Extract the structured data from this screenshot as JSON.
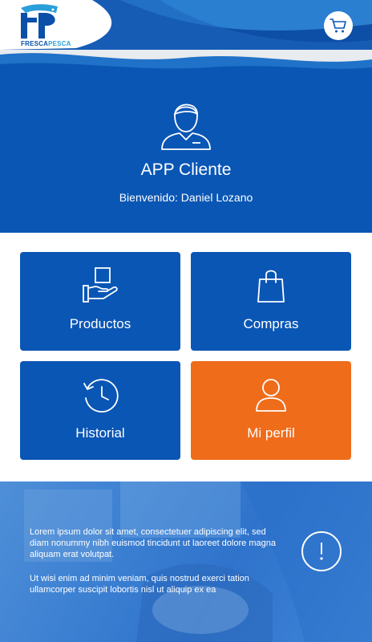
{
  "brand": {
    "name_part1": "FRESCA",
    "name_part2": "PESCA"
  },
  "header": {
    "cart_icon": "cart-icon"
  },
  "hero": {
    "icon": "user-avatar-icon",
    "title": "APP Cliente",
    "welcome": "Bienvenido: Daniel Lozano"
  },
  "tiles": [
    {
      "label": "Productos",
      "icon": "hand-box-icon",
      "color": "#0a56b5"
    },
    {
      "label": "Compras",
      "icon": "shopping-bag-icon",
      "color": "#0a56b5"
    },
    {
      "label": "Historial",
      "icon": "history-clock-icon",
      "color": "#0a56b5"
    },
    {
      "label": "Mi perfil",
      "icon": "profile-icon",
      "color": "#ef6c1a"
    }
  ],
  "footer": {
    "paragraph1": "Lorem ipsum dolor sit amet, consectetuer adipiscing elit, sed diam nonummy nibh euismod tincidunt ut laoreet dolore magna aliquam erat volutpat.",
    "paragraph2": "Ut wisi enim ad minim veniam, quis nostrud exerci tation ullamcorper suscipit lobortis nisl ut aliquip ex ea",
    "info_icon": "info-icon"
  },
  "colors": {
    "primary": "#0a56b5",
    "accent": "#ef6c1a",
    "header_wave": "#1f72c8"
  }
}
